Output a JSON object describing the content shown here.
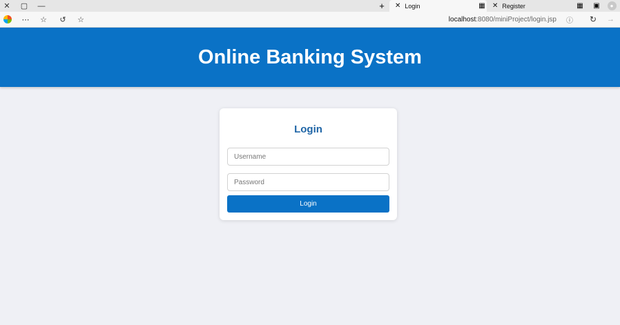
{
  "browser": {
    "tabs": [
      {
        "label": "Login",
        "active": true
      },
      {
        "label": "Register",
        "active": false
      }
    ],
    "address": {
      "host": "localhost",
      "path": ":8080/miniProject/login.jsp"
    },
    "icons": [
      "close-icon",
      "restore-icon",
      "minimize-icon",
      "new-tab-icon",
      "tab-close-icon",
      "sidebar-icon",
      "profile-icon",
      "browser-logo-icon",
      "more-icon",
      "favorites-icon",
      "collections-icon",
      "star-icon",
      "info-icon",
      "reload-icon",
      "forward-icon"
    ]
  },
  "header": {
    "title": "Online Banking System"
  },
  "login": {
    "heading": "Login",
    "username_placeholder": "Username",
    "password_placeholder": "Password",
    "submit_label": "Login"
  },
  "colors": {
    "primary": "#0a72c6",
    "heading": "#1f65a6",
    "background": "#eff0f5"
  }
}
